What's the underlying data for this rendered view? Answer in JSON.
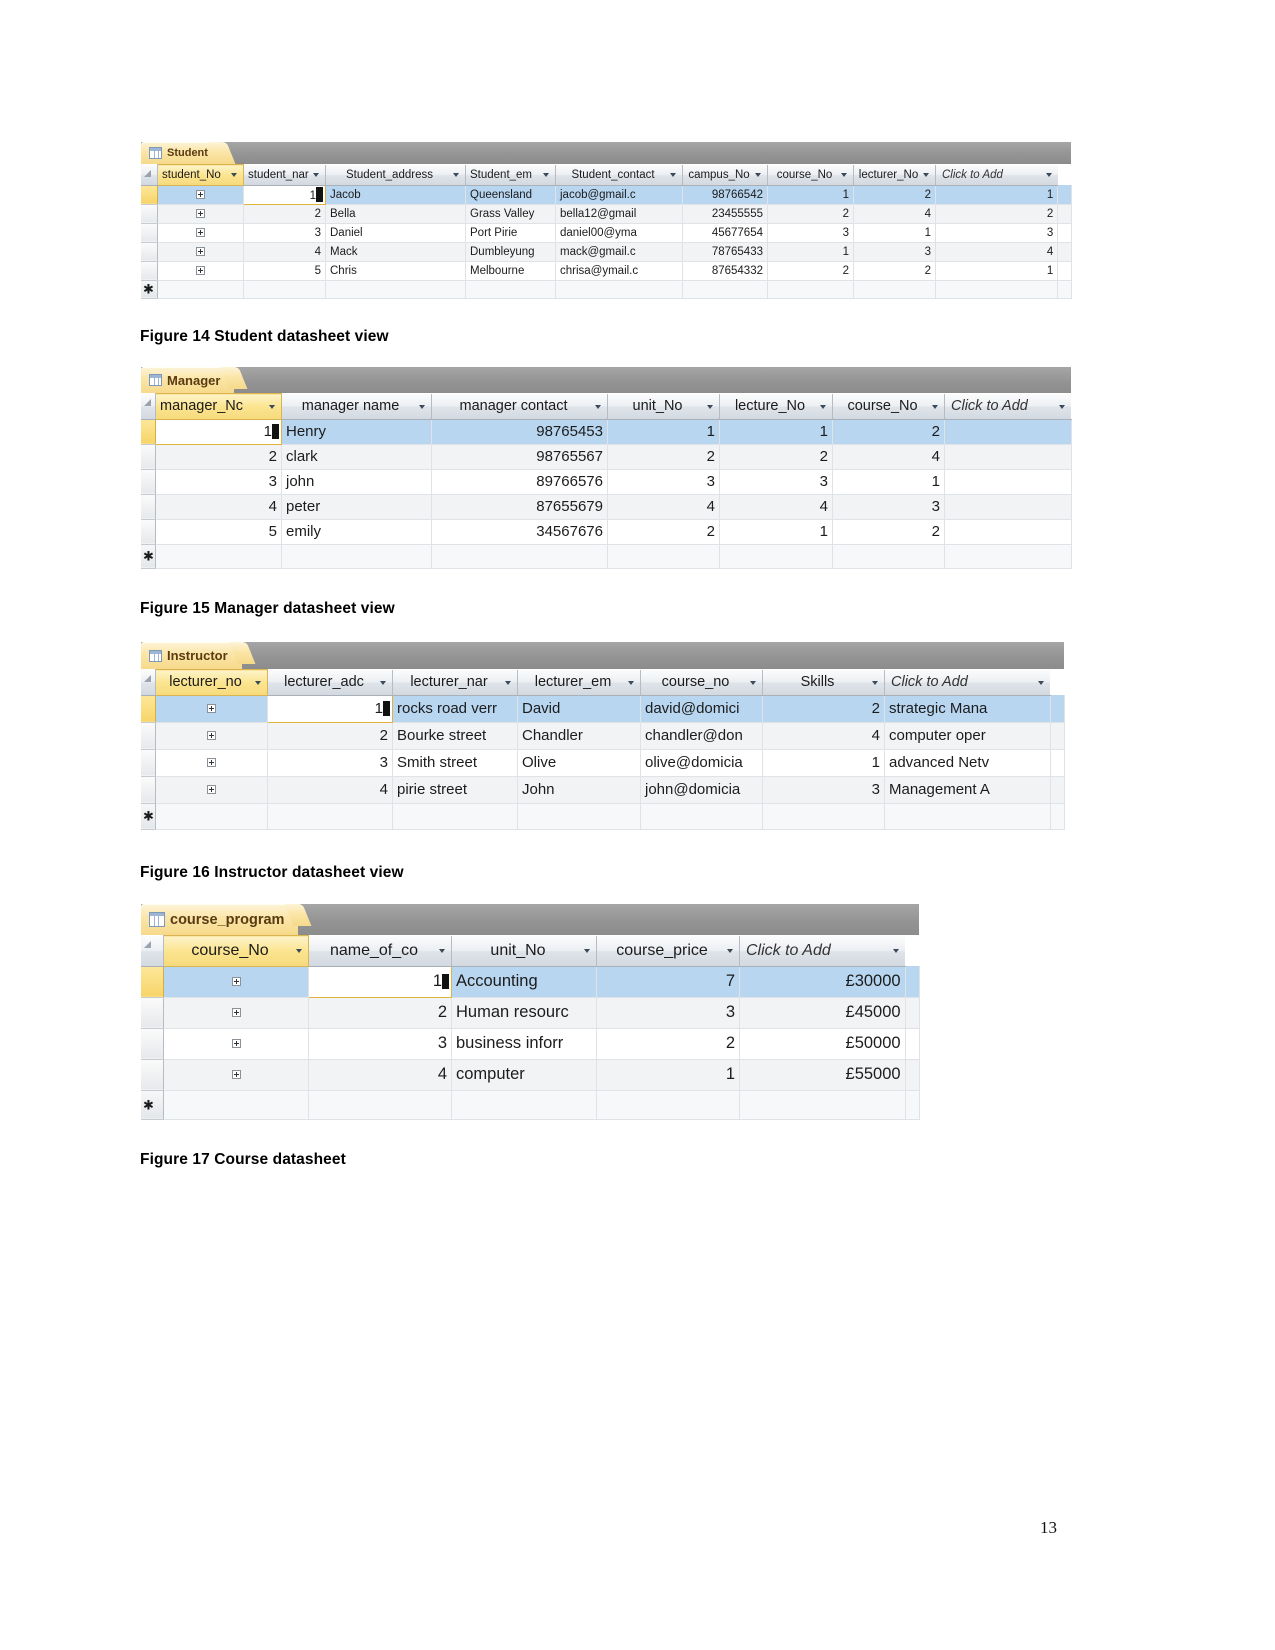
{
  "page": {
    "number": "13"
  },
  "captions": {
    "fig14": "Figure 14 Student datasheet view",
    "fig15": "Figure 15 Manager datasheet view",
    "fig16": "Figure 16 Instructor datasheet view",
    "fig17": "Figure 17 Course datasheet"
  },
  "common": {
    "click_to_add": "Click to Add",
    "expand_icon": "plus-icon",
    "dropdown_icon": "chevron-down-icon",
    "new_record_icon": "asterisk-icon",
    "table_icon": "table-icon"
  },
  "student": {
    "tab_label": "Student",
    "columns": [
      "student_No",
      "student_nar",
      "Student_address",
      "Student_em",
      "Student_contact",
      "campus_No",
      "course_No",
      "lecturer_No",
      "Click to Add"
    ],
    "rows": [
      {
        "student_No": "1",
        "student_nar": "Jacob",
        "Student_address": "Queensland",
        "Student_em": "jacob@gmail.c",
        "Student_contact": "98766542",
        "campus_No": "1",
        "course_No": "2",
        "lecturer_No": "1"
      },
      {
        "student_No": "2",
        "student_nar": "Bella",
        "Student_address": "Grass Valley",
        "Student_em": "bella12@gmail",
        "Student_contact": "23455555",
        "campus_No": "2",
        "course_No": "4",
        "lecturer_No": "2"
      },
      {
        "student_No": "3",
        "student_nar": "Daniel",
        "Student_address": "Port Pirie",
        "Student_em": "daniel00@yma",
        "Student_contact": "45677654",
        "campus_No": "3",
        "course_No": "1",
        "lecturer_No": "3"
      },
      {
        "student_No": "4",
        "student_nar": "Mack",
        "Student_address": "Dumbleyung",
        "Student_em": "mack@gmail.c",
        "Student_contact": "78765433",
        "campus_No": "1",
        "course_No": "3",
        "lecturer_No": "4"
      },
      {
        "student_No": "5",
        "student_nar": "Chris",
        "Student_address": "Melbourne",
        "Student_em": "chrisa@ymail.c",
        "Student_contact": "87654332",
        "campus_No": "2",
        "course_No": "2",
        "lecturer_No": "1"
      }
    ]
  },
  "manager": {
    "tab_label": "Manager",
    "columns": [
      "manager_Nc",
      "manager name",
      "manager contact",
      "unit_No",
      "lecture_No",
      "course_No",
      "Click to Add"
    ],
    "rows": [
      {
        "manager_No": "1",
        "manager_name": "Henry",
        "manager_contact": "98765453",
        "unit_No": "1",
        "lecture_No": "1",
        "course_No": "2"
      },
      {
        "manager_No": "2",
        "manager_name": "clark",
        "manager_contact": "98765567",
        "unit_No": "2",
        "lecture_No": "2",
        "course_No": "4"
      },
      {
        "manager_No": "3",
        "manager_name": "john",
        "manager_contact": "89766576",
        "unit_No": "3",
        "lecture_No": "3",
        "course_No": "1"
      },
      {
        "manager_No": "4",
        "manager_name": "peter",
        "manager_contact": "87655679",
        "unit_No": "4",
        "lecture_No": "4",
        "course_No": "3"
      },
      {
        "manager_No": "5",
        "manager_name": "emily",
        "manager_contact": "34567676",
        "unit_No": "2",
        "lecture_No": "1",
        "course_No": "2"
      }
    ]
  },
  "instructor": {
    "tab_label": "Instructor",
    "columns": [
      "lecturer_no",
      "lecturer_adc",
      "lecturer_nar",
      "lecturer_em",
      "course_no",
      "Skills",
      "Click to Add"
    ],
    "rows": [
      {
        "lecturer_no": "1",
        "lecturer_address": "rocks road verr",
        "lecturer_name": "David",
        "lecturer_email": "david@domici",
        "course_no": "2",
        "skills": "strategic Mana"
      },
      {
        "lecturer_no": "2",
        "lecturer_address": "Bourke street",
        "lecturer_name": "Chandler",
        "lecturer_email": "chandler@don",
        "course_no": "4",
        "skills": "computer oper"
      },
      {
        "lecturer_no": "3",
        "lecturer_address": "Smith street",
        "lecturer_name": "Olive",
        "lecturer_email": "olive@domicia",
        "course_no": "1",
        "skills": "advanced Netv"
      },
      {
        "lecturer_no": "4",
        "lecturer_address": "pirie street",
        "lecturer_name": "John",
        "lecturer_email": "john@domicia",
        "course_no": "3",
        "skills": "Management A"
      }
    ]
  },
  "course_program": {
    "tab_label": "course_program",
    "columns": [
      "course_No",
      "name_of_co",
      "unit_No",
      "course_price",
      "Click to Add"
    ],
    "rows": [
      {
        "course_No": "1",
        "name_of_course": "Accounting",
        "unit_No": "7",
        "course_price": "£30000"
      },
      {
        "course_No": "2",
        "name_of_course": "Human resourc",
        "unit_No": "3",
        "course_price": "£45000"
      },
      {
        "course_No": "3",
        "name_of_course": "business inforr",
        "unit_No": "2",
        "course_price": "£50000"
      },
      {
        "course_No": "4",
        "name_of_course": "computer",
        "unit_No": "1",
        "course_price": "£55000"
      }
    ]
  }
}
